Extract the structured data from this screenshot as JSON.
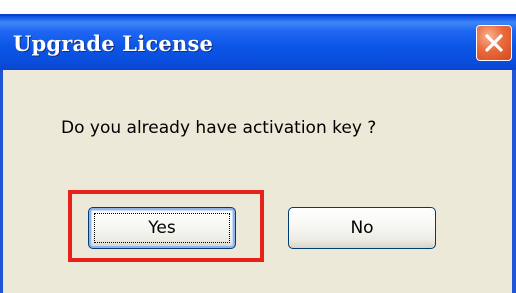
{
  "dialog": {
    "title": "Upgrade License",
    "message": "Do you already have activation key ?",
    "buttons": {
      "yes_label": "Yes",
      "no_label": "No"
    },
    "close_icon": "close-icon"
  },
  "colors": {
    "titlebar": "#0b55e6",
    "close_button": "#e0562a",
    "dialog_background": "#ece9d8",
    "highlight": "#e8221b"
  }
}
